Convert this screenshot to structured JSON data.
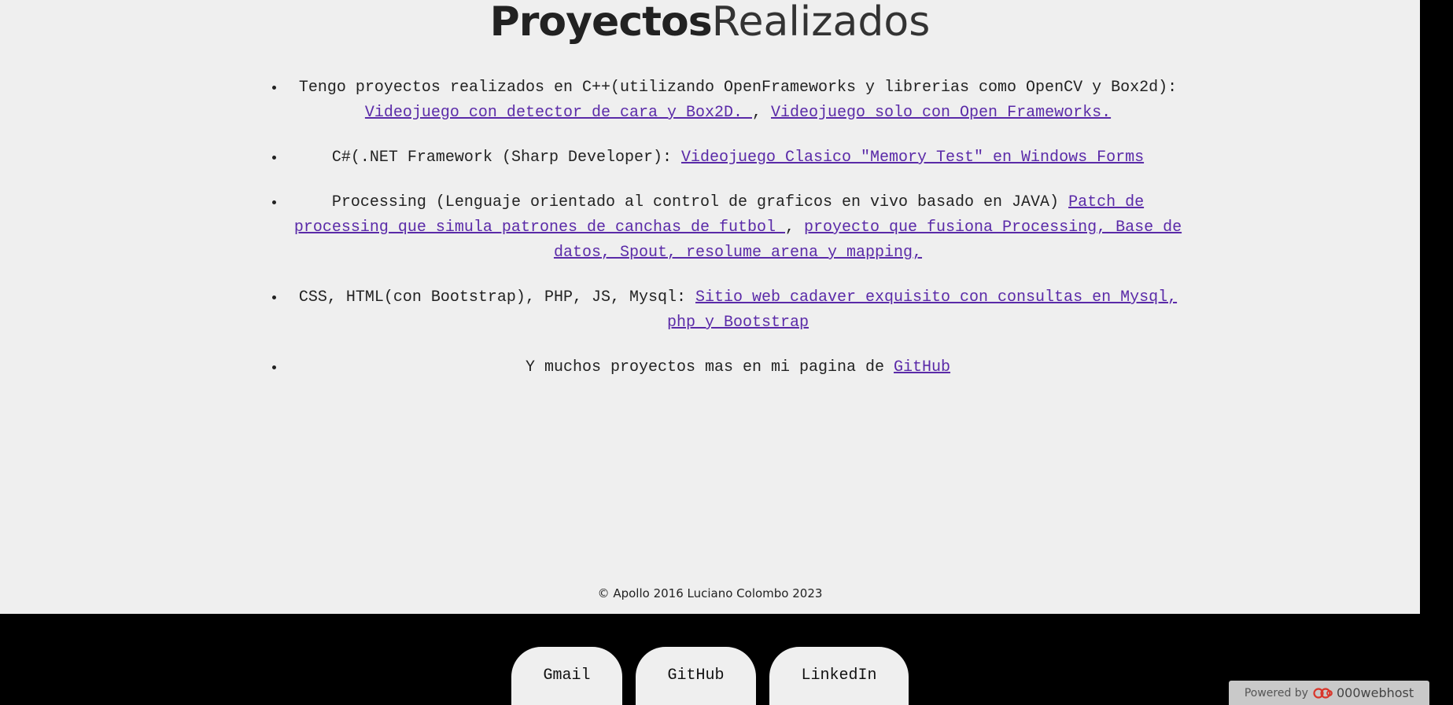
{
  "title": {
    "bold": "Proyectos",
    "light": "Realizados"
  },
  "projects": [
    {
      "text": "Tengo proyectos realizados en C++(utilizando OpenFrameworks y librerias como OpenCV y Box2d): ",
      "link1": "Videojuego con detector de cara y Box2D. ",
      "sep": ", ",
      "link2": "Videojuego solo con Open Frameworks."
    },
    {
      "text": "C#(.NET Framework (Sharp Developer): ",
      "link1": "Videojuego Clasico \"Memory Test\" en Windows Forms"
    },
    {
      "text": "Processing (Lenguaje orientado al control de graficos en vivo basado en JAVA) ",
      "link1": "Patch de processing que simula patrones de canchas de futbol ",
      "sep": ", ",
      "link2": "proyecto que fusiona Processing, Base de datos, Spout, resolume arena y mapping,"
    },
    {
      "text": "CSS, HTML(con Bootstrap), PHP, JS, Mysql: ",
      "link1": "Sitio web cadaver exquisito con consultas en Mysql, php y Bootstrap"
    },
    {
      "text": "Y muchos proyectos mas en mi pagina de ",
      "link1": "GitHub"
    }
  ],
  "footer": {
    "copyright": "© Apollo 2016 Luciano Colombo 2023"
  },
  "social": {
    "gmail": "Gmail",
    "github": "GitHub",
    "linkedin": "LinkedIn"
  },
  "powered": {
    "label": "Powered by",
    "brand": "000webhost",
    "icon": "000webhost-logo-icon"
  },
  "colors": {
    "page_bg": "#efefef",
    "footer_bg": "#000000",
    "link": "#5a2aa8"
  }
}
